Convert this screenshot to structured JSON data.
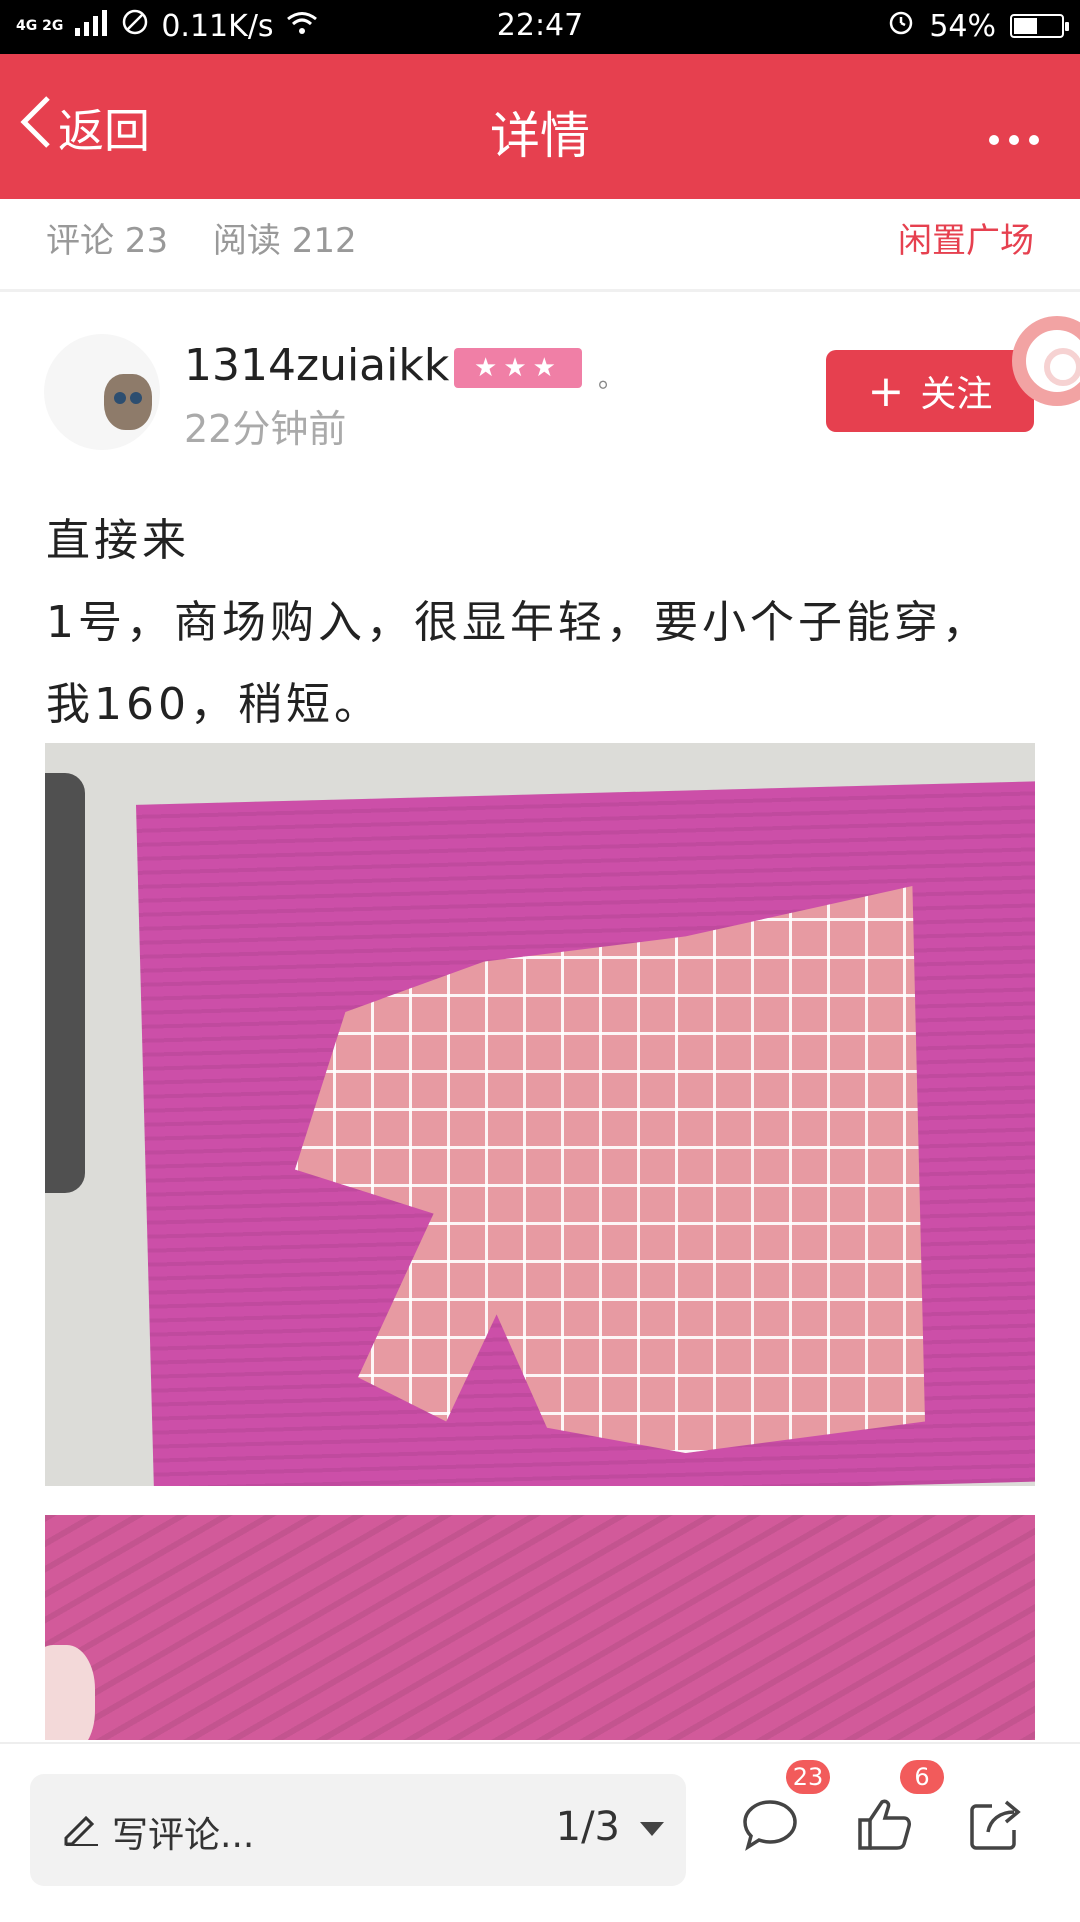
{
  "status_bar": {
    "network": "4G 2G",
    "speed": "0.11K/s",
    "time": "22:47",
    "battery": "54%",
    "battery_level": 0.54
  },
  "header": {
    "back_label": "返回",
    "title": "详情",
    "more_icon": "more-icon"
  },
  "meta": {
    "comments": "评论 23",
    "reads": "阅读 212",
    "section_link": "闲置广场"
  },
  "user": {
    "name": "1314zuiaikk",
    "rating": "★★★",
    "mark": "。",
    "posted": "22分钟前",
    "follow_label": "关注"
  },
  "post": {
    "line1": "直接来",
    "line2": "1号，商场购入，很显年轻，要小个子能穿，我160，稍短。"
  },
  "bottom": {
    "comment_placeholder": "写评论...",
    "page_indicator": "1/3",
    "comment_count": "23",
    "like_count": "6"
  },
  "colors": {
    "accent": "#e6404f",
    "badge": "#f25b5b",
    "rating_bg": "#f07fa6"
  }
}
